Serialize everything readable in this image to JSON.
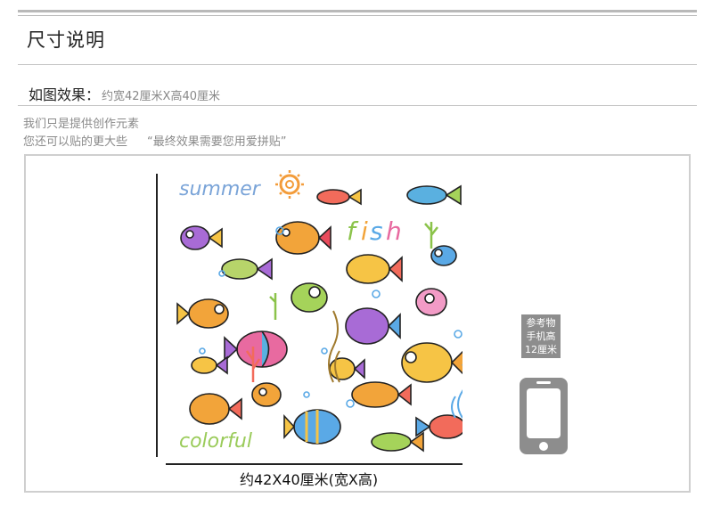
{
  "header": {
    "title": "尺寸说明"
  },
  "effect": {
    "label": "如图效果：",
    "value": "约宽42厘米X高40厘米"
  },
  "notes": {
    "line1": "我们只是提供创作元素",
    "line2": "您还可以贴的更大些",
    "quote": "“最终效果需要您用爱拼贴”"
  },
  "product": {
    "caption": "约42X40厘米(宽X高)",
    "decal_texts": {
      "summer": "summer",
      "fish": "fish",
      "colorful": "colorful"
    },
    "decal_colors": {
      "summer": "#7aa4d8",
      "fish_f": "#8bc34a",
      "fish_i": "#f2a43a",
      "fish_s": "#5aa9e6",
      "fish_h": "#e86aa0",
      "colorful": "#9acb5a",
      "sun": "#f39c3a"
    }
  },
  "reference": {
    "label_lines": [
      "参考物",
      "手机高",
      "12厘米"
    ],
    "icon": "phone-icon",
    "color": "#8d8d8d"
  }
}
